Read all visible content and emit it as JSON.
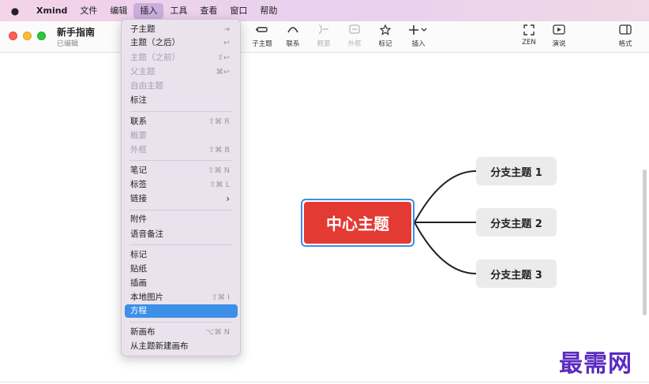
{
  "menubar": {
    "app_name": "Xmind",
    "items": [
      "文件",
      "编辑",
      "插入",
      "工具",
      "查看",
      "窗口",
      "帮助"
    ],
    "active_index": 2
  },
  "document": {
    "title": "新手指南",
    "status": "已编辑"
  },
  "toolbar": {
    "subtopic": {
      "label": "子主题",
      "icon": "subtopic-icon"
    },
    "relationship": {
      "label": "联系",
      "icon": "relationship-icon"
    },
    "summary": {
      "label": "概要",
      "icon": "summary-icon"
    },
    "boundary": {
      "label": "外框",
      "icon": "boundary-icon"
    },
    "marker": {
      "label": "标记",
      "icon": "star-icon"
    },
    "insert": {
      "label": "插入",
      "icon": "plus-icon"
    },
    "zen": {
      "label": "ZEN",
      "icon": "zen-icon"
    },
    "present": {
      "label": "演说",
      "icon": "play-icon"
    },
    "format": {
      "label": "格式",
      "icon": "panel-icon"
    }
  },
  "insert_menu": {
    "items": [
      {
        "label": "子主题",
        "shortcut": "⇥",
        "enabled": true
      },
      {
        "label": "主题（之后）",
        "shortcut": "↩",
        "enabled": true
      },
      {
        "label": "主题（之前）",
        "shortcut": "⇧↩",
        "enabled": false
      },
      {
        "label": "父主题",
        "shortcut": "⌘↩",
        "enabled": false
      },
      {
        "label": "自由主题",
        "shortcut": "",
        "enabled": false
      },
      {
        "label": "标注",
        "shortcut": "",
        "enabled": true
      },
      {
        "label": "联系",
        "shortcut": "⇧⌘ R",
        "enabled": true
      },
      {
        "label": "概要",
        "shortcut": "",
        "enabled": false
      },
      {
        "label": "外框",
        "shortcut": "⇧⌘ B",
        "enabled": false
      },
      {
        "label": "笔记",
        "shortcut": "⇧⌘ N",
        "enabled": true
      },
      {
        "label": "标签",
        "shortcut": "⇧⌘ L",
        "enabled": true
      },
      {
        "label": "链接",
        "shortcut": "",
        "enabled": true,
        "submenu": true
      },
      {
        "label": "附件",
        "shortcut": "",
        "enabled": true
      },
      {
        "label": "语音备注",
        "shortcut": "",
        "enabled": true
      },
      {
        "label": "标记",
        "shortcut": "",
        "enabled": true
      },
      {
        "label": "贴纸",
        "shortcut": "",
        "enabled": true
      },
      {
        "label": "插画",
        "shortcut": "",
        "enabled": true
      },
      {
        "label": "本地图片",
        "shortcut": "⇧⌘ I",
        "enabled": true
      },
      {
        "label": "方程",
        "shortcut": "",
        "enabled": true,
        "highlighted": true
      },
      {
        "label": "新画布",
        "shortcut": "⌥⌘ N",
        "enabled": true
      },
      {
        "label": "从主题新建画布",
        "shortcut": "",
        "enabled": true
      }
    ]
  },
  "mindmap": {
    "central_topic": "中心主题",
    "branches": [
      "分支主题 1",
      "分支主题 2",
      "分支主题 3"
    ]
  },
  "watermark": "最需网",
  "colors": {
    "central_topic": "#e43a34",
    "selection": "#3d8ee8",
    "menu_highlight": "#3e8fe8",
    "watermark": "#5a2bc0"
  }
}
